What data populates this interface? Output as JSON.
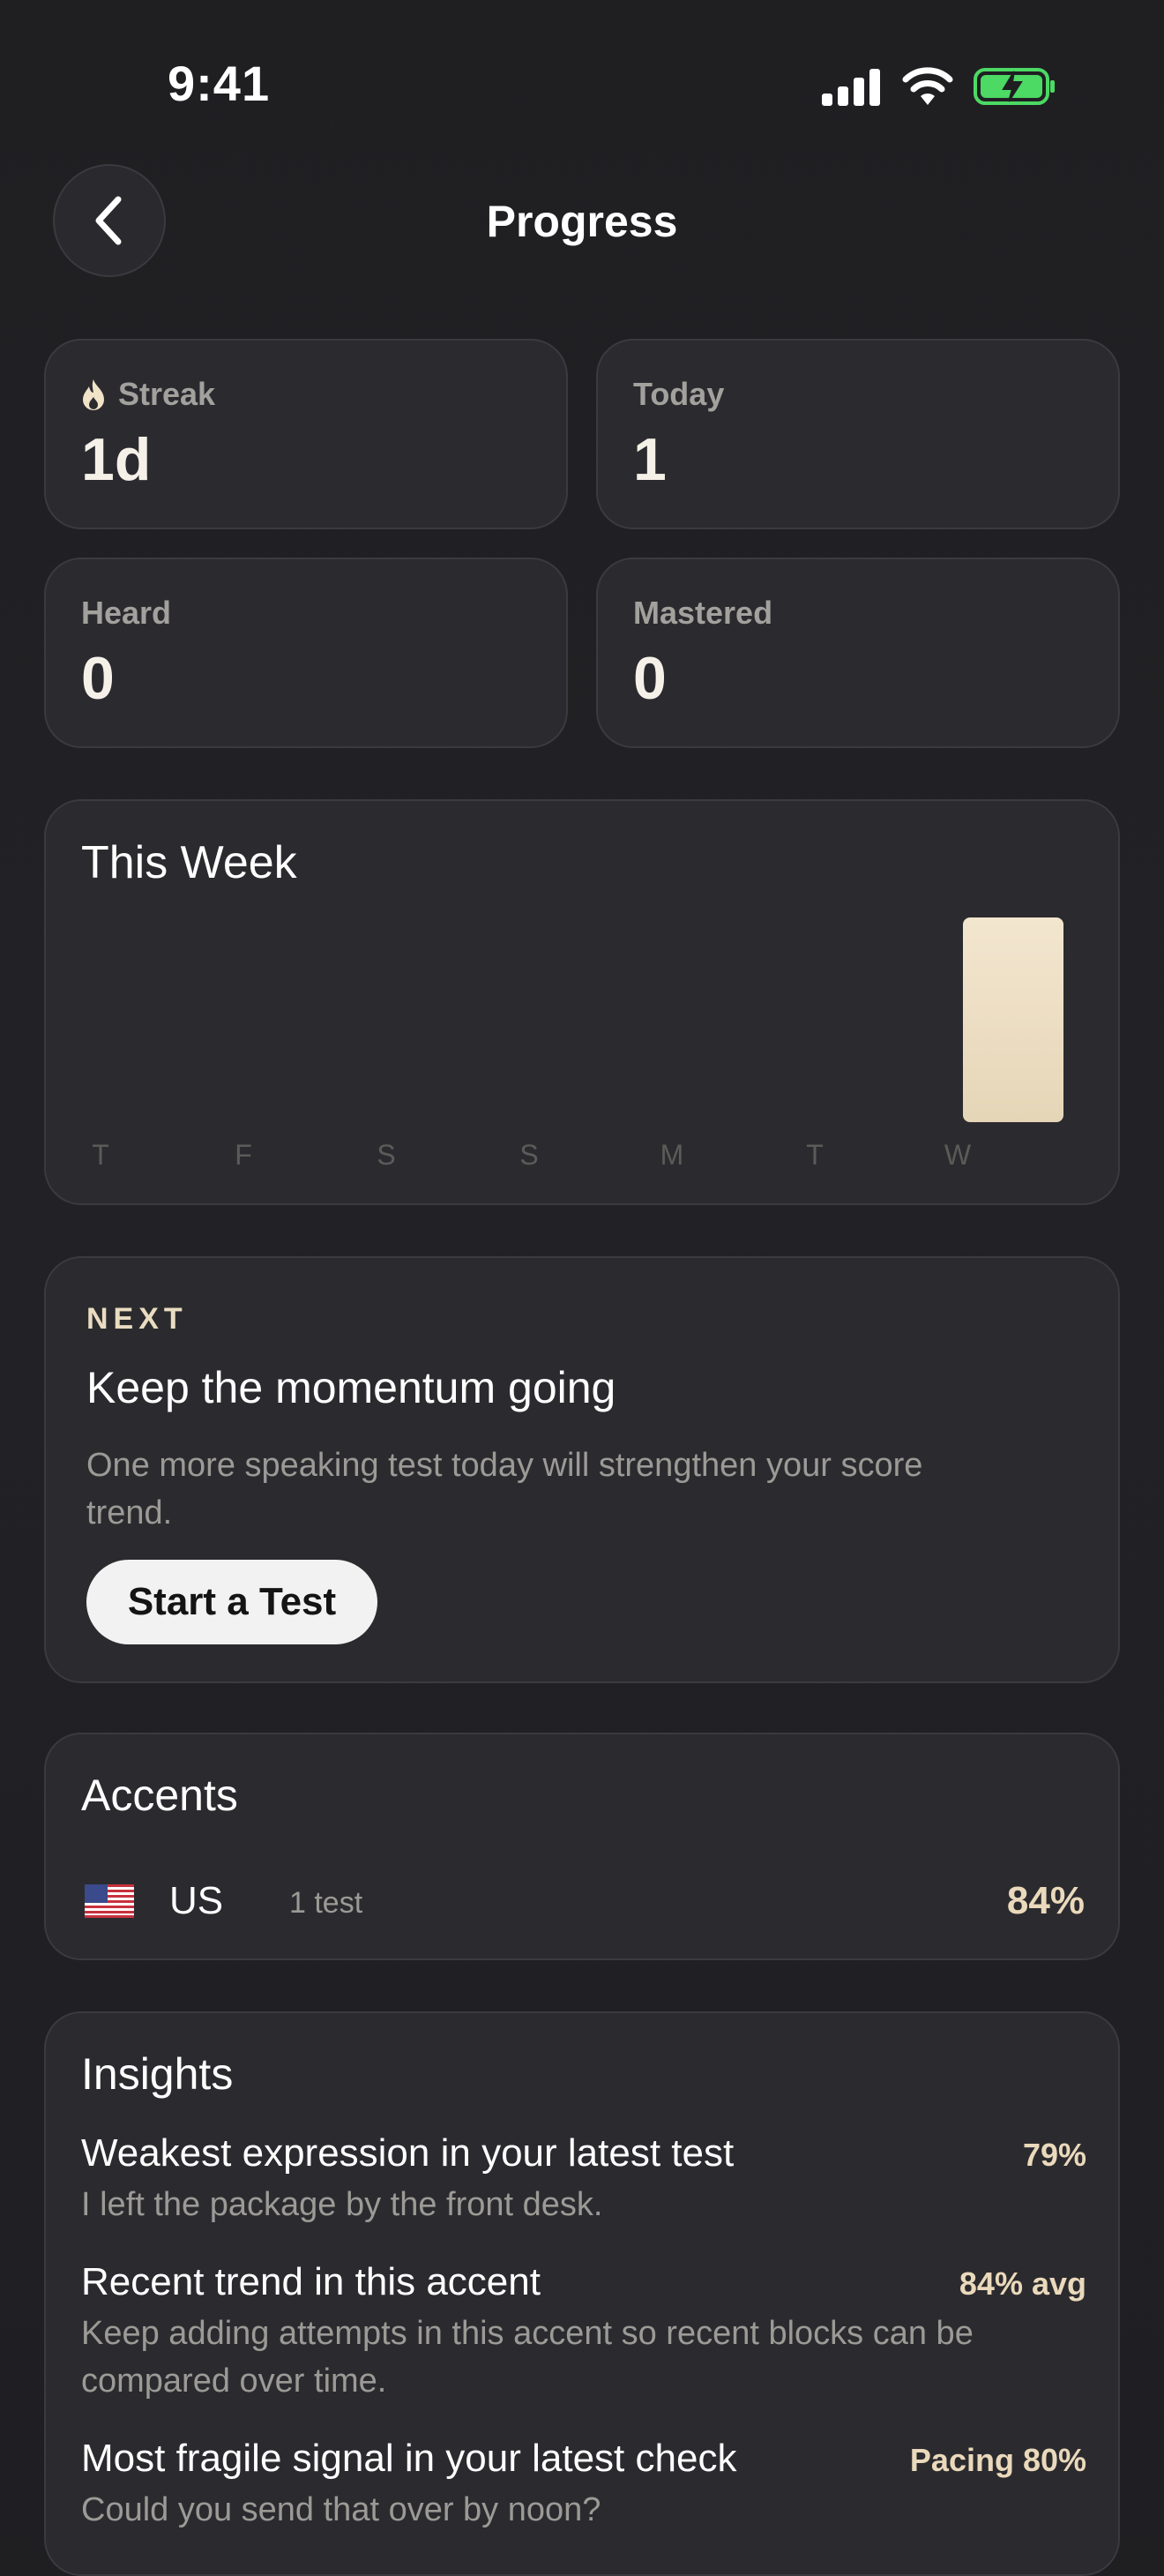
{
  "status_bar": {
    "time": "9:41"
  },
  "header": {
    "title": "Progress"
  },
  "stats": {
    "streak": {
      "label": "Streak",
      "value": "1d",
      "icon": "flame-icon"
    },
    "today": {
      "label": "Today",
      "value": "1"
    },
    "heard": {
      "label": "Heard",
      "value": "0"
    },
    "mastered": {
      "label": "Mastered",
      "value": "0"
    }
  },
  "this_week": {
    "title": "This Week"
  },
  "chart_data": {
    "type": "bar",
    "categories": [
      "T",
      "F",
      "S",
      "S",
      "M",
      "T",
      "W"
    ],
    "values": [
      0,
      0,
      0,
      0,
      0,
      0,
      1
    ],
    "title": "This Week",
    "ylim": [
      0,
      1
    ],
    "bar_color": "#f1e3c8"
  },
  "next": {
    "kicker": "NEXT",
    "title": "Keep the momentum going",
    "body": "One more speaking test today will strengthen your score trend.",
    "button_label": "Start a Test"
  },
  "accents": {
    "title": "Accents",
    "items": [
      {
        "flag": "us-flag-icon",
        "name": "US",
        "count": "1 test",
        "score": "84%"
      }
    ]
  },
  "insights": {
    "title": "Insights",
    "items": [
      {
        "title": "Weakest expression in your latest test",
        "metric": "79%",
        "description": "I left the package by the front desk."
      },
      {
        "title": "Recent trend in this accent",
        "metric": "84% avg",
        "description": "Keep adding attempts in this accent so recent blocks can be compared over time."
      },
      {
        "title": "Most fragile signal in your latest check",
        "metric": "Pacing 80%",
        "description": "Could you send that over by noon?"
      }
    ]
  },
  "colors": {
    "background": "#1f1f22",
    "card": "#2b2b2f",
    "accent": "#ead9bb",
    "battery": "#4cd964"
  }
}
